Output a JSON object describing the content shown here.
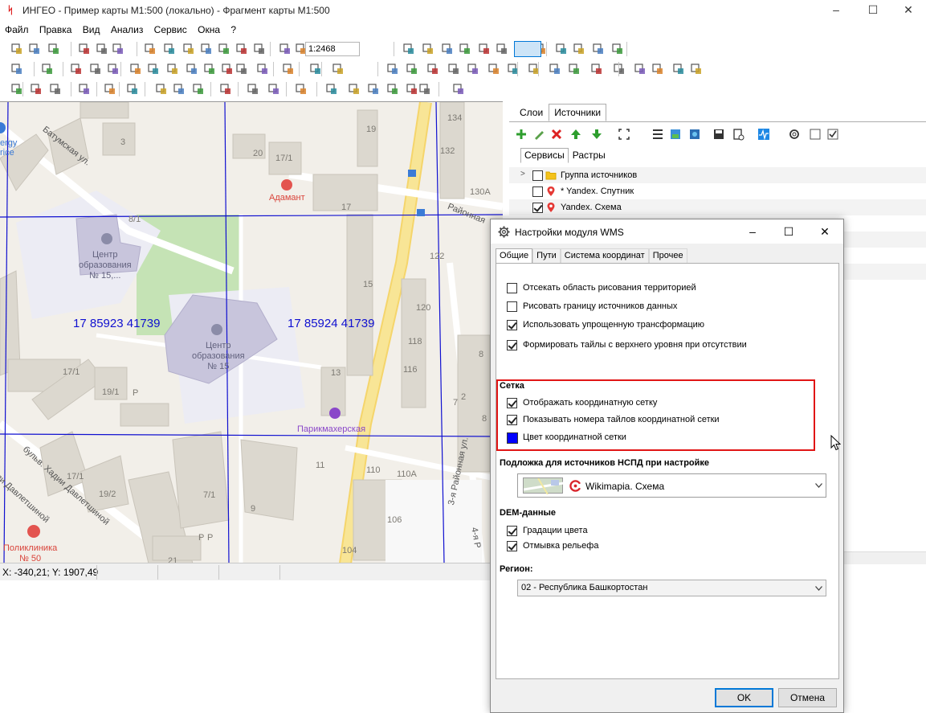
{
  "window": {
    "title": "ИНГЕО - Пример карты М1:500 (локально) - Фрагмент карты М1:500",
    "app_icon": "ingeo-logo-icon"
  },
  "menu": [
    "Файл",
    "Правка",
    "Вид",
    "Анализ",
    "Сервис",
    "Окна",
    "?"
  ],
  "toolbar": {
    "scale_value": "1:2468"
  },
  "map": {
    "tile_labels": [
      "17 85923 41739",
      "17 85924 41739"
    ],
    "poi": {
      "adamant": "Адамант",
      "barber": "Парикмахерская",
      "school_left": [
        "Центр",
        "образования",
        "№ 15,..."
      ],
      "school_right": [
        "Центр",
        "образования",
        "№ 15"
      ],
      "clinic": [
        "Поликлиника",
        "№ 50"
      ],
      "energy": [
        "ergy",
        "rice"
      ]
    },
    "street_labels": [
      "Батумская ул.",
      "Районная",
      "бульв. Хадии Давлетшиной",
      "ли Давлетшиной",
      "3-я Районная ул.",
      "4-я Р"
    ],
    "house_numbers": [
      "3",
      "20",
      "17/1",
      "19",
      "134",
      "132",
      "130А",
      "17",
      "8/1",
      "15",
      "122",
      "120",
      "118",
      "116",
      "13",
      "17/1",
      "19/1",
      "P",
      "17/1",
      "19/2",
      "7/1",
      "9",
      "11",
      "110",
      "110А",
      "106",
      "104",
      "21",
      "P",
      "P",
      "2",
      "8",
      "7",
      "8"
    ]
  },
  "statusbar": {
    "coords": "X: -340,21; Y: 1907,49"
  },
  "right_panel": {
    "tabs": [
      "Слои",
      "Источники"
    ],
    "active_tab": "Источники",
    "sub_tabs": [
      "Сервисы",
      "Растры"
    ],
    "tree": [
      {
        "label": "Группа источников",
        "checked": false,
        "icon": "folder-icon",
        "expandable": true
      },
      {
        "label": "* Yandex. Спутник",
        "checked": false,
        "icon": "map-pin-icon",
        "expandable": false
      },
      {
        "label": "Yandex. Схема",
        "checked": true,
        "icon": "map-pin-icon",
        "expandable": false
      }
    ]
  },
  "dialog": {
    "title": "Настройки модуля WMS",
    "tabs": [
      "Общие",
      "Пути",
      "Система координат",
      "Прочее"
    ],
    "active_tab": "Общие",
    "general_options": [
      {
        "label": "Отсекать область рисования территорией",
        "checked": false
      },
      {
        "label": "Рисовать границу источников данных",
        "checked": false
      },
      {
        "label": "Использовать упрощенную трансформацию",
        "checked": true
      },
      {
        "label": "Формировать тайлы с верхнего уровня при отсутствии",
        "checked": true
      }
    ],
    "grid_section": {
      "title": "Сетка",
      "show_grid": {
        "label": "Отображать координатную сетку",
        "checked": true
      },
      "show_tile_numbers": {
        "label": "Показывать номера тайлов координатной сетки",
        "checked": true
      },
      "grid_color": {
        "label": "Цвет координатной сетки",
        "value": "#0000ff"
      }
    },
    "nspd_section": {
      "title": "Подложка для источников  НСПД  при настройке",
      "selected": "Wikimapia. Схема"
    },
    "dem_section": {
      "title": "DEM-данные",
      "options": [
        {
          "label": "Градации цвета",
          "checked": true
        },
        {
          "label": "Отмывка рельефа",
          "checked": true
        }
      ]
    },
    "region_section": {
      "title": "Регион:",
      "selected": "02 - Республика Башкортостан"
    },
    "ok_label": "OK",
    "cancel_label": "Отмена"
  }
}
